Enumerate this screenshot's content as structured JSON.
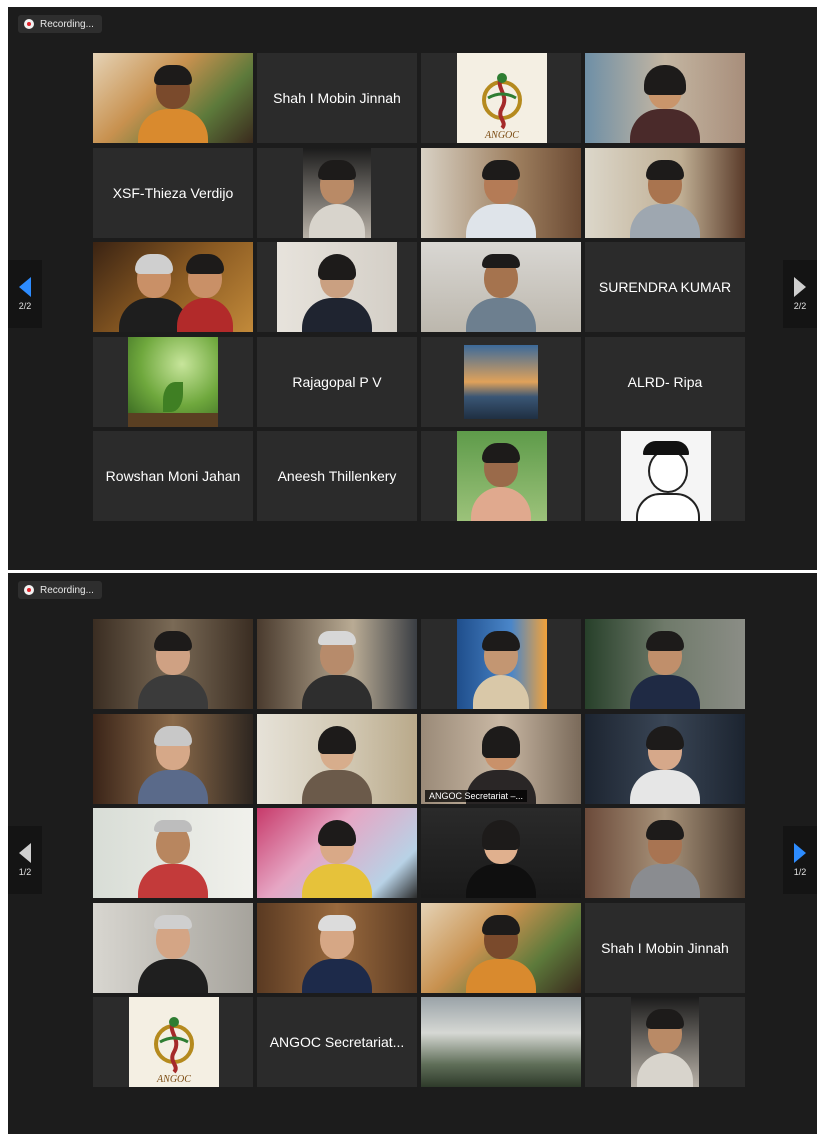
{
  "colors": {
    "accent": "#2d8cff",
    "active_speaker": "#d6df3a",
    "recording_dot": "#e0242c",
    "background": "#1c1c1c",
    "tile": "#2b2b2b"
  },
  "page1": {
    "recording_label": "Recording...",
    "nav_left_page": "2/2",
    "nav_right_page": "2/2",
    "names": {
      "shah_mobin_jinnah": "Shah I Mobin Jinnah",
      "xsf_thieza": "XSF-Thieza Verdijo",
      "surendra_kumar": "SURENDRA KUMAR",
      "rajagopal": "Rajagopal P V",
      "alrd_ripa": "ALRD- Ripa",
      "rowshan": "Rowshan Moni Jahan",
      "aneesh": "Aneesh Thillenkery"
    },
    "angoc_logo_text": "ANGOC"
  },
  "page2": {
    "recording_label": "Recording...",
    "nav_left_page": "1/2",
    "nav_right_page": "1/2",
    "active_speaker_label": "ANGOC Secretariat –...",
    "names": {
      "shah_mobin_jinnah": "Shah I Mobin Jinnah",
      "angoc_secretariat": "ANGOC Secretariat..."
    },
    "angoc_logo_text": "ANGOC"
  }
}
